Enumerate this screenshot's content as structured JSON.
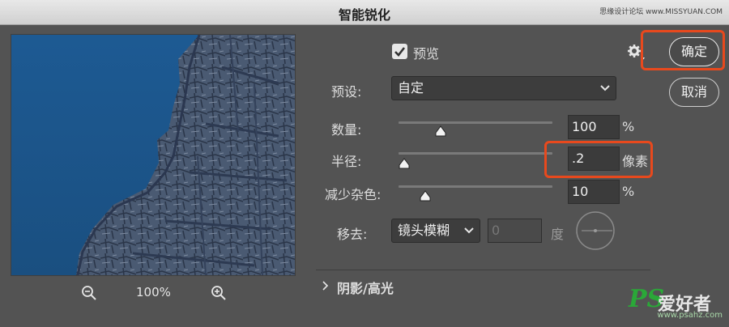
{
  "window": {
    "title": "智能锐化",
    "watermark": "思缘设计论坛 www.MISSYUAN.COM"
  },
  "preview": {
    "zoom_level": "100%"
  },
  "options": {
    "preview_label": "预览",
    "preview_checked": true,
    "preset_label": "预设:",
    "preset_value": "自定",
    "amount_label": "数量:",
    "amount_value": "100",
    "amount_unit": "%",
    "amount_fraction": 0.2,
    "radius_label": "半径:",
    "radius_value": ".2",
    "radius_unit": "像素",
    "radius_fraction": 0.0,
    "noise_label": "减少杂色:",
    "noise_value": "10",
    "noise_unit": "%",
    "noise_fraction": 0.1,
    "remove_label": "移去:",
    "remove_value": "镜头模糊",
    "angle_value": "0",
    "angle_unit": "度"
  },
  "buttons": {
    "ok": "确定",
    "cancel": "取消"
  },
  "section": {
    "shadows_highlights": "阴影/高光"
  },
  "logo": {
    "brand": "PS",
    "cn": "爱好者",
    "url": "www.psahz.com"
  },
  "colors": {
    "highlight": "#e8491d",
    "sky": "#1f5588"
  }
}
